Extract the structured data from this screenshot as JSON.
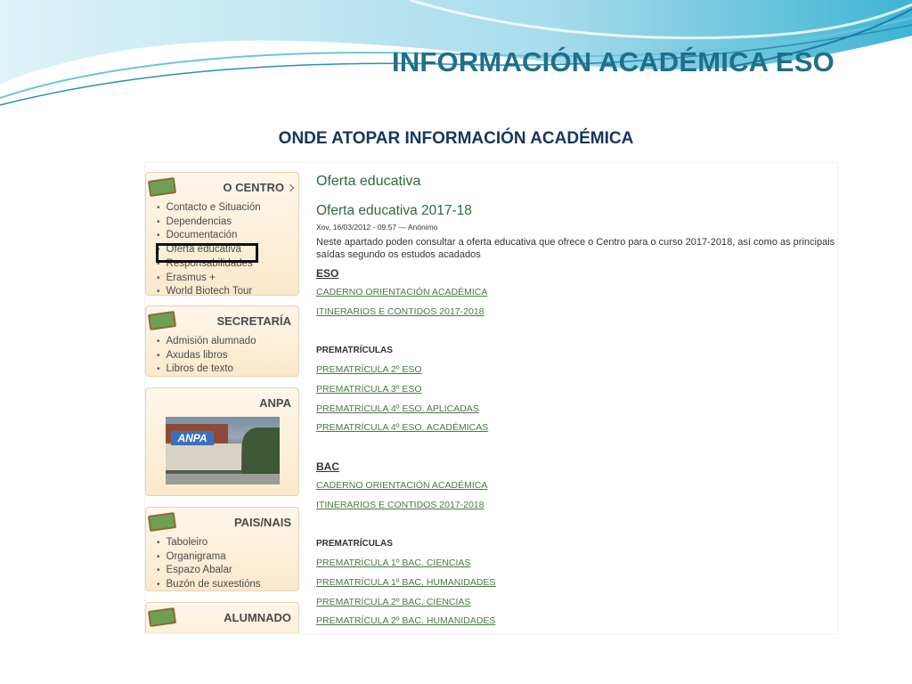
{
  "slide": {
    "title": "INFORMACIÓN ACADÉMICA ESO",
    "subtitle": "ONDE ATOPAR INFORMACIÓN ACADÉMICA"
  },
  "sidebar": {
    "centro": {
      "title": "O CENTRO",
      "items": [
        "Contacto e Situación",
        "Dependencias",
        "Documentación",
        "Oferta educativa",
        "Responsabilidades",
        "Erasmus +",
        "World Biotech Tour"
      ],
      "highlighted": "Oferta educativa"
    },
    "secretaria": {
      "title": "SECRETARÍA",
      "items": [
        "Admisión alumnado",
        "Axudas libros",
        "Libros de texto"
      ]
    },
    "anpa": {
      "title": "ANPA",
      "image_sign": "ANPA"
    },
    "pais": {
      "title": "PAIS/NAIS",
      "items": [
        "Taboleiro",
        "Organigrama",
        "Espazo Abalar",
        "Buzón de suxestións"
      ]
    },
    "alumnado": {
      "title": "ALUMNADO"
    }
  },
  "content": {
    "page_heading": "Oferta educativa",
    "article_title": "Oferta educativa 2017-18",
    "meta": "Xov, 16/03/2012 - 09:57 — Anónimo",
    "intro": "Neste apartado poden consultar a oferta educativa que ofrece o Centro para o curso 2017-2018, así como as principais saídas segundo os estudos acadados",
    "eso": {
      "heading": "ESO",
      "links": [
        "CADERNO ORIENTACIÓN ACADÉMICA",
        "ITINERARIOS E CONTIDOS 2017-2018"
      ],
      "prematriculas_heading": "PREMATRÍCULAS",
      "prematriculas": [
        "PREMATRÍCULA 2º ESO",
        "PREMATRÍCULA 3º ESO",
        "PREMATRÍCULA 4º ESO. APLICADAS",
        "PREMATRÍCULA 4º ESO. ACADÉMICAS"
      ]
    },
    "bac": {
      "heading": "BAC",
      "links": [
        "CADERNO ORIENTACIÓN ACADÉMICA",
        "ITINERARIOS E CONTIDOS 2017-2018"
      ],
      "prematriculas_heading": "PREMATRÍCULAS",
      "prematriculas": [
        "PREMATRÍCULA 1º BAC. CIENCIAS",
        "PREMATRÍCULA 1º BAC. HUMANIDADES",
        "PREMATRÍCULA 2º BAC. CIENCIAS",
        "PREMATRÍCULA 2º BAC. HUMANIDADES"
      ]
    }
  },
  "colors": {
    "title": "#1f6f8b",
    "subtitle": "#17365d",
    "content_green": "#2d6b3d",
    "wave_light": "#bfe6f2",
    "wave_dark": "#2aa7c9"
  }
}
